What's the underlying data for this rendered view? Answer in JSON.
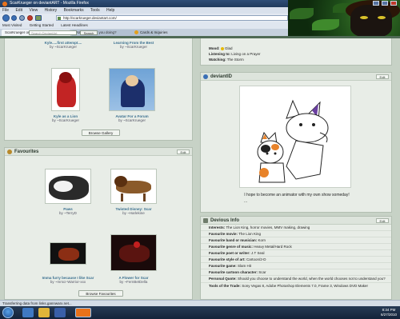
{
  "window": {
    "title": "ScarKrueger on deviantART - Mozilla Firefox"
  },
  "menu": [
    "File",
    "Edit",
    "View",
    "History",
    "Bookmarks",
    "Tools",
    "Help"
  ],
  "nav": {
    "url": "http://scarkrueger.deviantart.com/",
    "search_placeholder": "Kam"
  },
  "bookmarks": [
    "Most Visited",
    "Getting Started",
    "Latest Headlines"
  ],
  "da_bar": {
    "search_placeholder": "Search DeviantArt",
    "search_button": "Search",
    "cards_label": "Cards & Inquiries"
  },
  "tabs": [
    {
      "label": "ScarKrueger on deviantART"
    },
    {
      "label": "Poll: What are you doing?"
    }
  ],
  "gallery": {
    "top_captions": [
      {
        "title": "Kyle.....first attempt....",
        "by": "by ~ScarKrueger"
      },
      {
        "title": "Learning From the Best",
        "by": "by ~ScarKrueger"
      }
    ],
    "items": [
      {
        "title": "Kyle as a Lion",
        "by": "by ~ScarKrueger"
      },
      {
        "title": "Avatar For a Forum",
        "by": "by ~ScarKrueger"
      }
    ],
    "button": "Browse Gallery"
  },
  "favourites": {
    "title": "Favourites",
    "edit": "Edit",
    "items": [
      {
        "title": "Paws",
        "by": "by ~TerryD"
      },
      {
        "title": "Twisted Disney: Scar",
        "by": "by ~Harlekine"
      },
      {
        "title": "Imma furry because I like Scar",
        "by": "by ~mrscr-Warrior-xxx"
      },
      {
        "title": "A Flower for Scar",
        "by": "by ~FernBetDella"
      }
    ],
    "button": "Browse Favourites"
  },
  "about": {
    "mood_label": "Mood:",
    "mood_value": "Glad",
    "listening_label": "Listening to:",
    "listening_value": "Living on a Prayer",
    "watching_label": "Watching:",
    "watching_value": "The Storm"
  },
  "deviantid": {
    "title": "deviantID",
    "edit": "Edit",
    "caption": "I hope to become an animator with my own show someday!",
    "more": "..."
  },
  "devious": {
    "title": "Devious Info",
    "edit": "Edit",
    "rows": [
      {
        "label": "Interests:",
        "value": "The Lion King, horror movies, MMV making, drawing"
      },
      {
        "label": "Favourite movie:",
        "value": "The Lion King"
      },
      {
        "label": "Favourite band or musician:",
        "value": "Korn"
      },
      {
        "label": "Favourite genre of music:",
        "value": "Heavy Metal/Hard Rock"
      },
      {
        "label": "Favourite poet or writer:",
        "value": "J.T Seal"
      },
      {
        "label": "Favourite style of art:",
        "value": "Cartoon/2-D"
      },
      {
        "label": "Favourite game:",
        "value": "Slam Hit"
      },
      {
        "label": "Favourite cartoon character:",
        "value": "Scar"
      },
      {
        "label": "Personal Quote:",
        "value": "Should you choose to understand the world, when the world chooses not to understand you?"
      },
      {
        "label": "Tools of the Trade:",
        "value": "Sony Vegas 8, Adobe Photoshop Elements 7.0, Frame 3, Windows DVD Maker"
      }
    ]
  },
  "status_text": "Transferring data from links.gannwarx.net...",
  "clock": {
    "time": "8:34 PM",
    "date": "6/27/2010"
  },
  "colors": {
    "page_bg": "#c7d2c6",
    "panel_bg": "#e8ede7",
    "link": "#3a6f8f",
    "taskbar": "#13233a"
  }
}
